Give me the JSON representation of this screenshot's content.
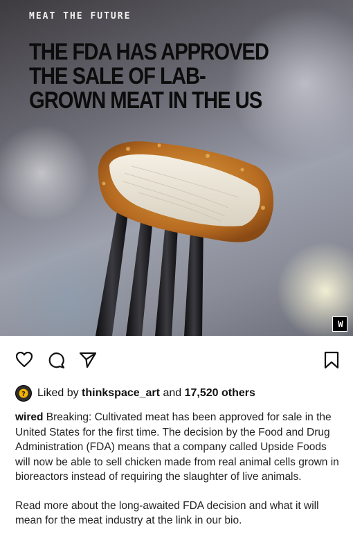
{
  "post": {
    "image": {
      "kicker": "MEAT THE FUTURE",
      "headline": "THE FDA HAS APPROVED THE SALE OF LAB-GROWN MEAT IN THE US",
      "logo_text": "W"
    },
    "actions": {
      "like_icon": "heart-icon",
      "comment_icon": "comment-icon",
      "share_icon": "send-icon",
      "save_icon": "bookmark-icon"
    },
    "likes": {
      "prefix": "Liked by",
      "user": "thinkspace_art",
      "connector": "and",
      "count": "17,520 others"
    },
    "caption": {
      "username": "wired",
      "text": " Breaking: Cultivated meat has been approved for sale in the United States for the first time. The decision by the Food and Drug Administration (FDA) means that a company called Upside Foods will now be able to sell chicken made from real animal cells grown in bioreactors instead of requiring the slaughter of live animals.",
      "second_paragraph": "Read more about the long-awaited FDA decision and what it will mean for the meat industry at the link in our bio."
    }
  },
  "colors": {
    "text": "#111111",
    "background": "#ffffff"
  }
}
